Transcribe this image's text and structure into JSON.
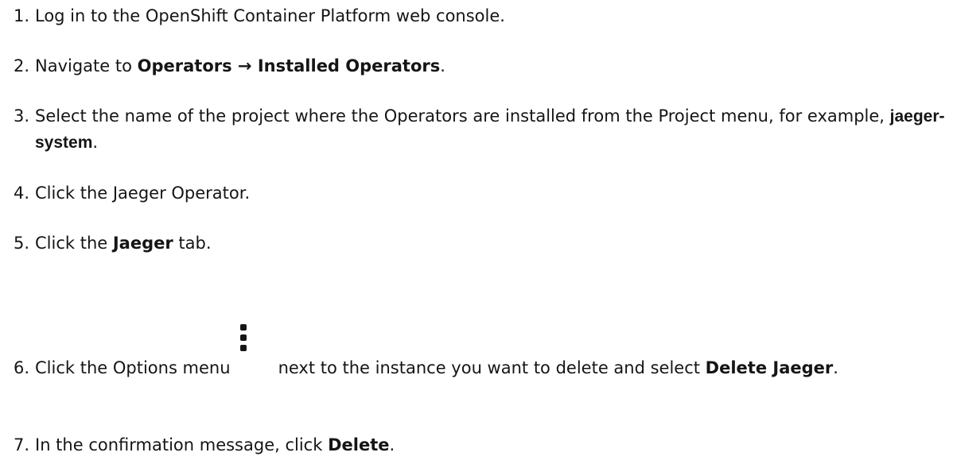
{
  "steps": [
    {
      "num": "1.",
      "text": "Log in to the OpenShift Container Platform web console."
    },
    {
      "num": "2.",
      "pre": "Navigate to ",
      "bold": "Operators → Installed Operators",
      "post": "."
    },
    {
      "num": "3.",
      "pre": "Select the name of the project where the Operators are installed from the Project menu, for example, ",
      "code": "jaeger-system",
      "post": "."
    },
    {
      "num": "4.",
      "text": "Click the Jaeger Operator."
    },
    {
      "num": "5.",
      "pre": "Click the ",
      "bold": "Jaeger",
      "post": " tab."
    },
    {
      "num": "6.",
      "pre": "Click the Options menu",
      "icon": "kebab-menu-icon",
      "mid": "next to the instance you want to delete and select ",
      "bold": "Delete Jaeger",
      "post": "."
    },
    {
      "num": "7.",
      "pre": "In the confirmation message, click ",
      "bold": "Delete",
      "post": "."
    }
  ]
}
